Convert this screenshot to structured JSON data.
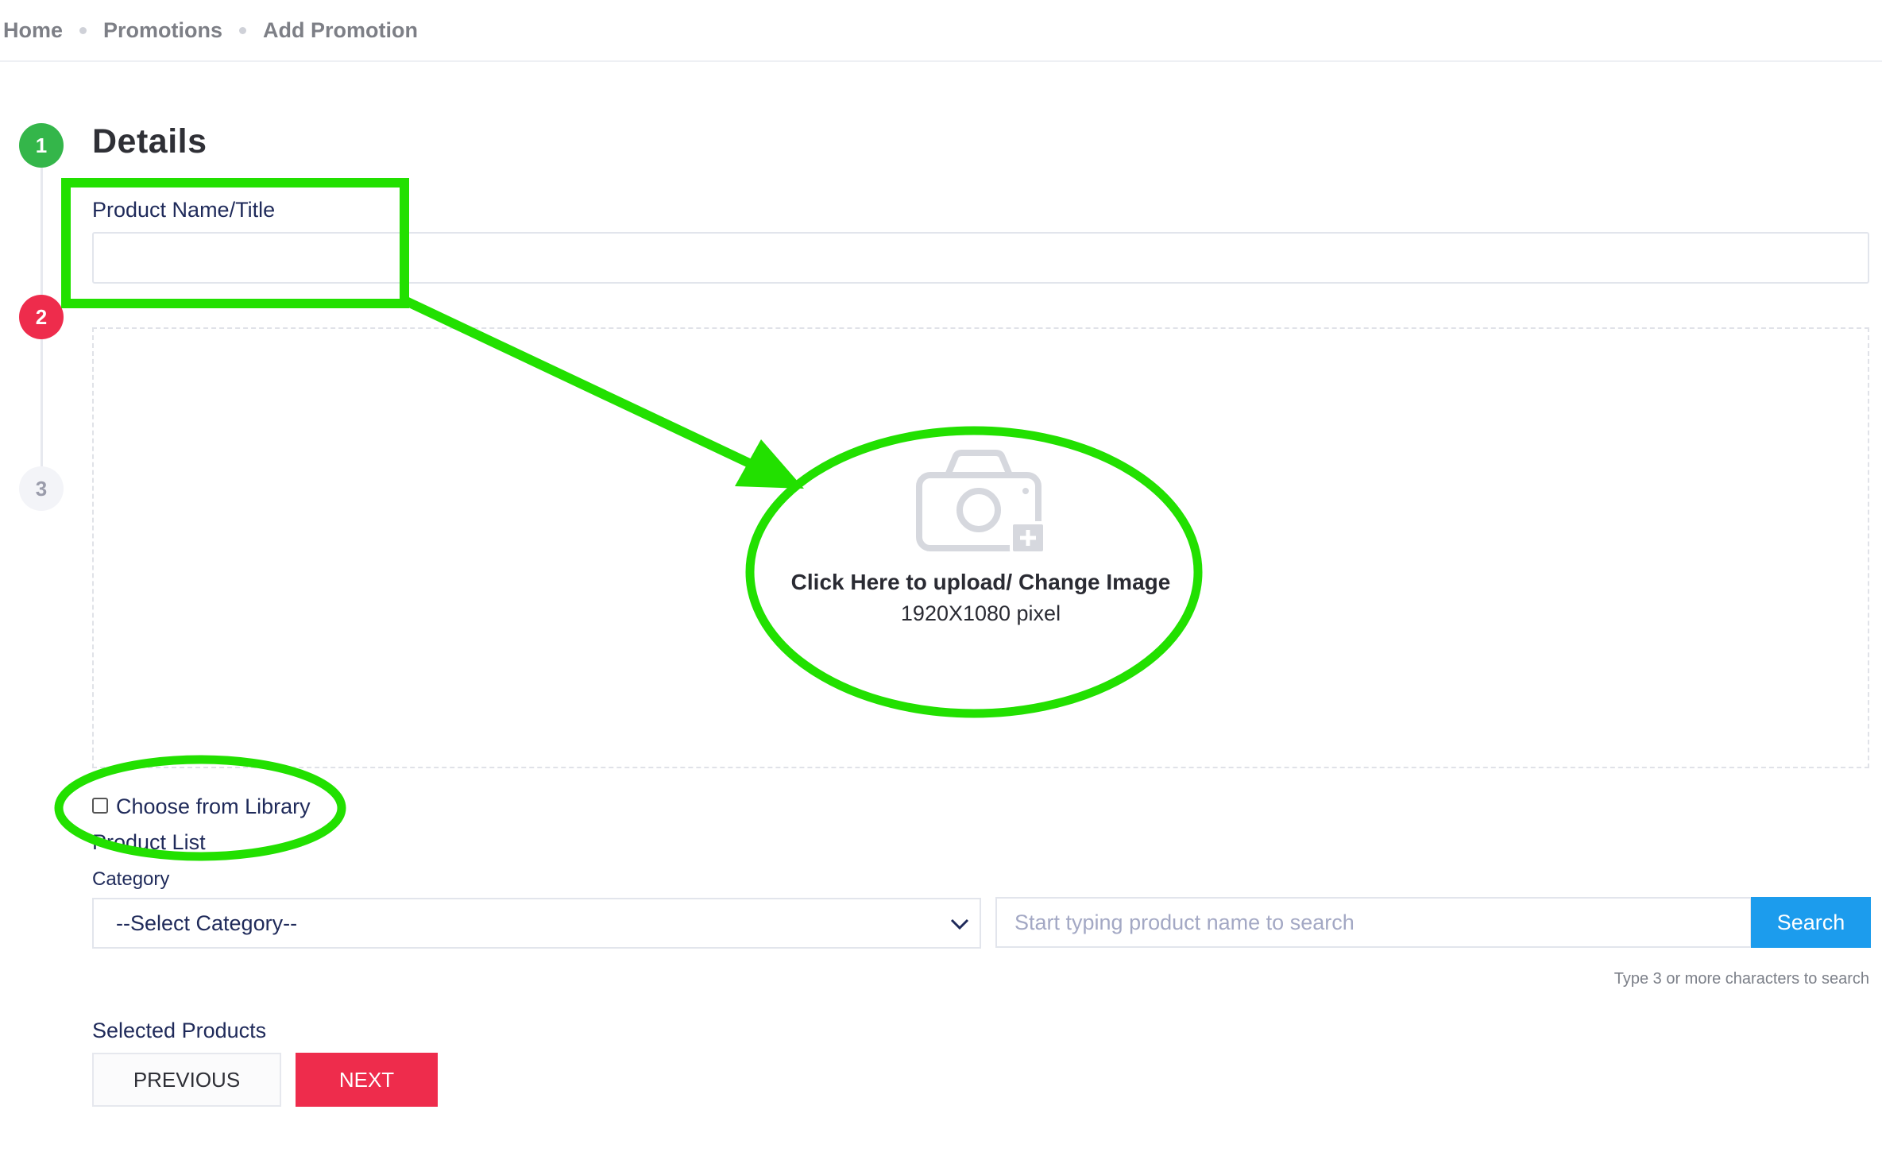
{
  "breadcrumb": [
    "Home",
    "Promotions",
    "Add Promotion"
  ],
  "steps": [
    "1",
    "2",
    "3"
  ],
  "section_title": "Details",
  "product_name": {
    "label": "Product Name/Title",
    "value": ""
  },
  "upload": {
    "title": "Click Here to upload/ Change Image",
    "subtitle": "1920X1080 pixel",
    "icon": "camera-plus-icon"
  },
  "library": {
    "label": "Choose from Library",
    "checked": false
  },
  "product_list_label": "Product List",
  "category": {
    "label": "Category",
    "selected": "--Select Category--"
  },
  "search": {
    "placeholder": "Start typing product name to search",
    "button": "Search",
    "hint": "Type 3 or more characters to search"
  },
  "selected_products_label": "Selected Products",
  "buttons": {
    "previous": "PREVIOUS",
    "next": "NEXT"
  },
  "colors": {
    "step_done": "#34b64a",
    "step_active": "#ee2c4c",
    "accent": "#1c9ced",
    "annotation": "#22e000"
  }
}
